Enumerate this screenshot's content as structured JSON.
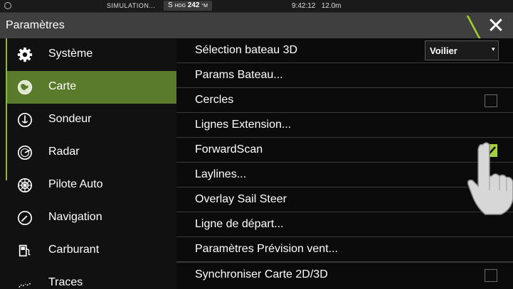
{
  "status": {
    "sim": "SIMULATION...",
    "hdg_prefix": "S",
    "hdg_label": "HDG",
    "hdg_value": "242",
    "hdg_unit": "°M",
    "time": "9:42:12",
    "depth": "12.0m"
  },
  "title": "Paramètres",
  "sidebar": {
    "items": [
      {
        "label": "Système",
        "icon": "gear-icon",
        "active": false
      },
      {
        "label": "Carte",
        "icon": "chart-icon",
        "active": true
      },
      {
        "label": "Sondeur",
        "icon": "sonar-icon",
        "active": false
      },
      {
        "label": "Radar",
        "icon": "radar-icon",
        "active": false
      },
      {
        "label": "Pilote Auto",
        "icon": "autopilot-icon",
        "active": false
      },
      {
        "label": "Navigation",
        "icon": "compass-icon",
        "active": false
      },
      {
        "label": "Carburant",
        "icon": "fuel-icon",
        "active": false
      },
      {
        "label": "Traces",
        "icon": "tracks-icon",
        "active": false
      }
    ]
  },
  "main": {
    "rows": [
      {
        "label": "Sélection bateau 3D",
        "type": "select",
        "value": "Voilier"
      },
      {
        "label": "Params Bateau...",
        "type": "link"
      },
      {
        "label": "Cercles",
        "type": "checkbox",
        "checked": false
      },
      {
        "label": "Lignes Extension...",
        "type": "link"
      },
      {
        "label": "ForwardScan",
        "type": "checkbox",
        "checked": true
      },
      {
        "label": "Laylines...",
        "type": "link"
      },
      {
        "label": "Overlay Sail Steer",
        "type": "checkbox",
        "checked": false
      },
      {
        "label": "Ligne de départ...",
        "type": "link"
      },
      {
        "label": "Paramètres Prévision vent...",
        "type": "link"
      },
      {
        "label": "Synchroniser Carte 2D/3D",
        "type": "checkbox",
        "checked": false
      }
    ]
  },
  "colors": {
    "accent": "#8db83a",
    "active_bg": "#5a7b2b",
    "checkbox_on": "#a9d13d",
    "titlebar": "#3f3f3f"
  }
}
